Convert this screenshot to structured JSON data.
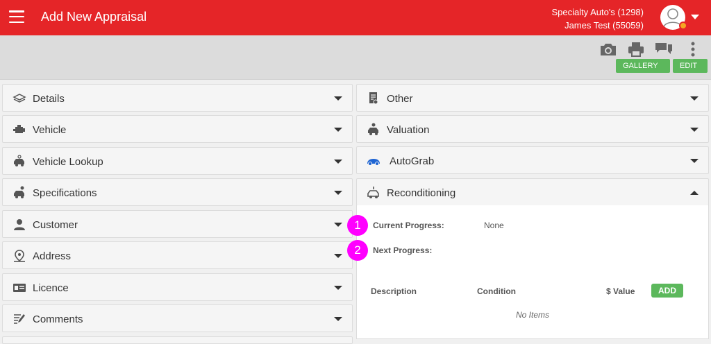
{
  "header": {
    "title": "Add New Appraisal",
    "dealer_name": "Specialty Auto's (1298)",
    "user_name": "James Test (55059)"
  },
  "toolbar": {
    "gallery_label": "GALLERY",
    "edit_label": "EDIT",
    "icons": [
      "camera-icon",
      "print-icon",
      "chat-icon",
      "more-vertical-icon"
    ]
  },
  "left_panels": [
    {
      "label": "Details",
      "icon": "stack-icon"
    },
    {
      "label": "Vehicle",
      "icon": "engine-icon"
    },
    {
      "label": "Vehicle Lookup",
      "icon": "car-search-icon"
    },
    {
      "label": "Specifications",
      "icon": "car-settings-icon"
    },
    {
      "label": "Customer",
      "icon": "person-icon"
    },
    {
      "label": "Address",
      "icon": "location-pin-icon"
    },
    {
      "label": "Licence",
      "icon": "id-card-icon"
    },
    {
      "label": "Comments",
      "icon": "notes-icon"
    }
  ],
  "right_panels": [
    {
      "label": "Other",
      "icon": "document-icon"
    },
    {
      "label": "Valuation",
      "icon": "car-dollar-icon"
    },
    {
      "label": "AutoGrab",
      "icon": "autograb-logo-icon"
    },
    {
      "label": "Reconditioning",
      "icon": "car-wrench-icon",
      "expanded": true
    }
  ],
  "reconditioning": {
    "current_progress_label": "Current Progress:",
    "current_progress_value": "None",
    "next_progress_label": "Next Progress:",
    "next_progress_value": "",
    "columns": [
      "Description",
      "Condition",
      "$ Value"
    ],
    "add_label": "ADD",
    "empty_text": "No Items"
  },
  "badges": [
    "1",
    "2"
  ],
  "colors": {
    "header_red": "#e52528",
    "action_green": "#5cb85c",
    "badge_magenta": "#ff00ff",
    "status_orange": "#f5a623",
    "autograb_blue": "#1e64d2"
  }
}
